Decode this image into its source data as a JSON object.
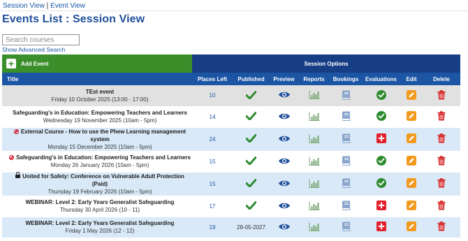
{
  "nav": {
    "session_view": "Session View",
    "separator": "|",
    "event_view": "Event View"
  },
  "page_title": "Events List : Session View",
  "search": {
    "placeholder": "Search courses",
    "value": ""
  },
  "advanced_search": "Show Advanced Search",
  "table": {
    "add_event": "Add Event",
    "session_options": "Session Options",
    "headers": {
      "title": "Title",
      "places_left": "Places Left",
      "published": "Published",
      "preview": "Preview",
      "reports": "Reports",
      "bookings": "Bookings",
      "evaluations": "Evaluations",
      "edit": "Edit",
      "delete": "Delete"
    },
    "rows": [
      {
        "name": "TEst event",
        "date": "Friday 10 October 2025 (13:00 - 17:00)",
        "places": "10",
        "published": "check",
        "evaluation": "check-circle",
        "flag": ""
      },
      {
        "name": "Safeguarding's in Education: Empowering Teachers and Learners",
        "date": "Wednesday 19 November 2025 (10am - 5pm)",
        "places": "14",
        "published": "check",
        "evaluation": "check-circle",
        "flag": ""
      },
      {
        "name": "External Course - How to use the Phew Learning management system",
        "date": "Monday 15 December 2025 (10am - 5pm)",
        "places": "24",
        "published": "check",
        "evaluation": "plus-square",
        "flag": "blocked"
      },
      {
        "name": "Safeguarding's in Education: Empowering Teachers and Learners",
        "date": "Monday 26 January 2026 (10am - 5pm)",
        "places": "15",
        "published": "check",
        "evaluation": "check-circle",
        "flag": "blocked"
      },
      {
        "name": "United for Safety: Conference on Vulnerable Adult Protection (Paid)",
        "date": "Thursday 19 February 2026 (10am - 5pm)",
        "places": "15",
        "published": "check",
        "evaluation": "check-circle",
        "flag": "lock"
      },
      {
        "name": "WEBINAR: Level 2: Early Years Generalist Safeguarding",
        "date": "Thursday 30 April 2026 (10 - 11)",
        "places": "17",
        "published": "check",
        "evaluation": "plus-square",
        "flag": ""
      },
      {
        "name": "WEBINAR: Level 2: Early Years Generalist Safeguarding",
        "date": "Friday 1 May 2026 (12 - 12)",
        "places": "19",
        "published": "28-05-2027",
        "evaluation": "plus-square",
        "flag": ""
      }
    ]
  },
  "colors": {
    "title_blue": "#1f4f9a",
    "header_blue": "#1b55a4",
    "session_options_bg": "#173e84",
    "add_event_green": "#3b8f2a",
    "check_green": "#2e8b2e",
    "eval_red": "#e0202a",
    "edit_orange": "#f39a1e",
    "delete_red": "#d41c1c",
    "reports_green": "#7aa874",
    "bookings_blue": "#8aa6cc",
    "eye_blue": "#1f4f9a",
    "row_alt": "#d9e9f7",
    "row_first": "#e1e1e1"
  }
}
